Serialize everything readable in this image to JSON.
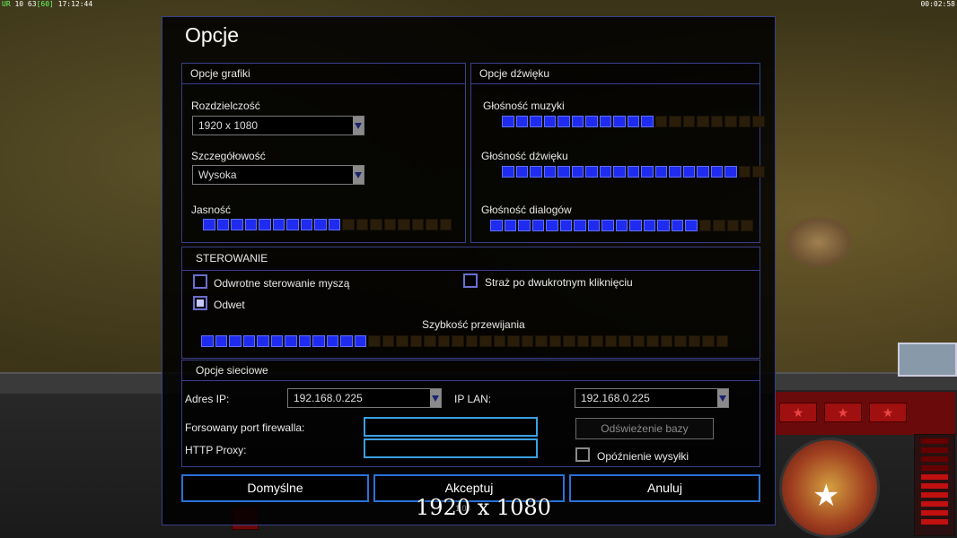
{
  "hud": {
    "left_prefix": "UR",
    "left_mid": "10 63",
    "left_fps": "[60]",
    "left_time": "17:12:44",
    "right_time": "00:02:58"
  },
  "dialog": {
    "title": "Opcje",
    "graphics": {
      "header": "Opcje grafiki",
      "resolution_label": "Rozdzielczość",
      "resolution_value": "1920 x 1080",
      "detail_label": "Szczegółowość",
      "detail_value": "Wysoka",
      "brightness_label": "Jasność",
      "brightness_level": 10,
      "brightness_segments": 18
    },
    "sound": {
      "header": "Opcje dźwięku",
      "music_label": "Głośność muzyki",
      "music_level": 11,
      "music_segments": 19,
      "sfx_label": "Głośność dźwięku",
      "sfx_level": 17,
      "sfx_segments": 19,
      "dialog_label": "Głośność dialogów",
      "dialog_level": 15,
      "dialog_segments": 19
    },
    "controls": {
      "header": "STEROWANIE",
      "invert_mouse_label": "Odwrotne sterowanie myszą",
      "invert_mouse_checked": false,
      "guard_doubleclick_label": "Straż po dwukrotnym kliknięciu",
      "guard_doubleclick_checked": false,
      "retaliation_label": "Odwet",
      "retaliation_checked": true,
      "scroll_speed_label": "Szybkość przewijania",
      "scroll_speed_level": 12,
      "scroll_speed_segments": 38
    },
    "network": {
      "header": "Opcje sieciowe",
      "ip_label": "Adres IP:",
      "ip_value": "192.168.0.225",
      "lan_label": "IP LAN:",
      "lan_value": "192.168.0.225",
      "firewall_label": "Forsowany port firewalla:",
      "firewall_value": "",
      "proxy_label": "HTTP Proxy:",
      "proxy_value": "",
      "refresh_label": "Odświeżenie bazy",
      "delay_label": "Opóźnienie wysyłki",
      "delay_checked": false
    },
    "buttons": {
      "defaults": "Domyślne",
      "accept": "Akceptuj",
      "cancel": "Anuluj"
    }
  },
  "caption": "1920 x 1080",
  "caption_small": "1.04"
}
